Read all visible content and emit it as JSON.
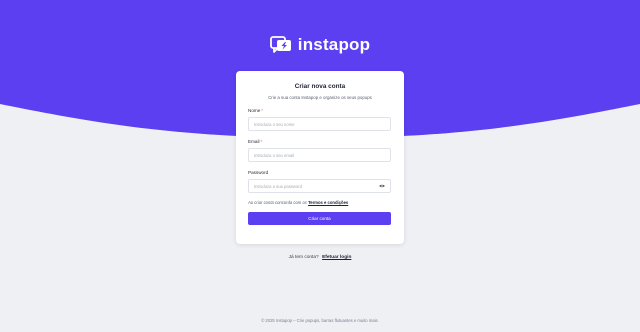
{
  "brand": {
    "name": "instapop"
  },
  "colors": {
    "primary": "#5b3ff0",
    "background": "#eef0f3",
    "card": "#ffffff"
  },
  "signup": {
    "title": "Criar nova conta",
    "subtitle": "Crie a sua conta Instapop e organize os seus popups",
    "fields": [
      {
        "label": "Nome",
        "required": "*",
        "placeholder": "Introduza o seu nome"
      },
      {
        "label": "Email",
        "required": "*",
        "placeholder": "Introduza o seu email"
      },
      {
        "label": "Password",
        "required": "",
        "placeholder": "Introduza a sua password"
      }
    ],
    "terms_text": "Ao criar conta concorda com os",
    "terms_link": "Termos e condições",
    "submit_label": "Criar conta"
  },
  "login": {
    "text": "Já tem conta?",
    "link": "Efetuar login"
  },
  "footer": {
    "text": "© 2025 Instapop – Crie popups, barras flutuantes e muito mais."
  },
  "icons": {
    "brand": "chat-bubble-bolt-icon",
    "password_toggle": "eye-icon"
  }
}
